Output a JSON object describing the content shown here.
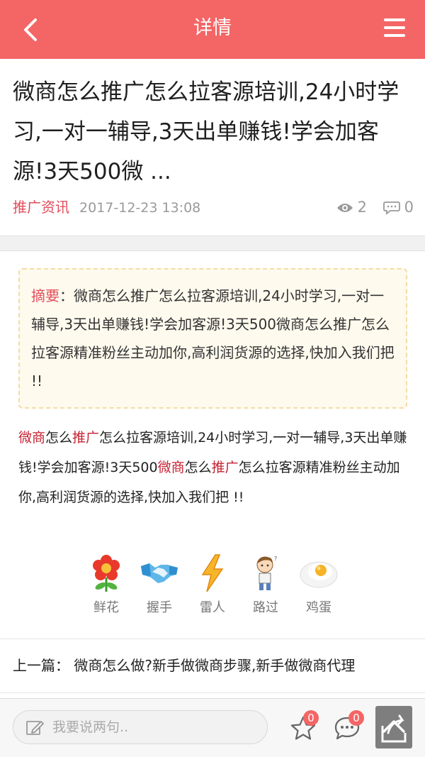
{
  "header": {
    "title": "详情",
    "back_icon": "chevron-left-icon",
    "menu_icon": "hamburger-menu-icon",
    "bg_color": "#f46565"
  },
  "article": {
    "title": "微商怎么推广怎么拉客源培训,24小时学习,一对一辅导,3天出单赚钱!学会加客源!3天500微 ...",
    "category": "推广资讯",
    "date": "2017-12-23 13:08",
    "views": "2",
    "comments": "0"
  },
  "summary": {
    "label": "摘要",
    "text": "：微商怎么推广怎么拉客源培训,24小时学习,一对一辅导,3天出单赚钱!学会加客源!3天500微商怎么推广怎么拉客源精准粉丝主动加你,高利润货源的选择,快加入我们把 !!"
  },
  "body": {
    "segments": [
      {
        "text": "微商",
        "kw": true
      },
      {
        "text": "怎么",
        "kw": false
      },
      {
        "text": "推广",
        "kw": true
      },
      {
        "text": "怎么拉客源培训,24小时学习,一对一辅导,3天出单赚钱!学会加客源!3天500",
        "kw": false
      },
      {
        "text": "微商",
        "kw": true
      },
      {
        "text": "怎么",
        "kw": false
      },
      {
        "text": "推广",
        "kw": true
      },
      {
        "text": "怎么拉客源精准粉丝主动加你,高利润货源的选择,快加入我们把 !!",
        "kw": false
      }
    ]
  },
  "reactions": [
    {
      "label": "鲜花",
      "icon": "flower-icon"
    },
    {
      "label": "握手",
      "icon": "handshake-icon"
    },
    {
      "label": "雷人",
      "icon": "lightning-icon"
    },
    {
      "label": "路过",
      "icon": "passerby-icon"
    },
    {
      "label": "鸡蛋",
      "icon": "egg-icon"
    }
  ],
  "prev_article": {
    "text": "上一篇：  微商怎么做?新手做微商步骤,新手做微商代理"
  },
  "bottombar": {
    "placeholder": "我要说两句..",
    "favorites_count": "0",
    "comments_count": "0"
  }
}
